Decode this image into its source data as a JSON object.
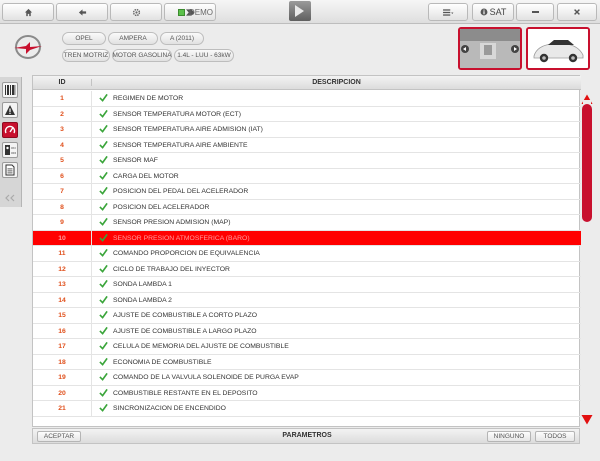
{
  "toolbar": {
    "demo_label": "DEMO",
    "sat_label": "SAT"
  },
  "vehicle": {
    "tags": [
      "OPEL",
      "AMPERA",
      "A (2011)",
      "TREN MOTRIZ",
      "MOTOR GASOLINA",
      "1.4L - LUU - 63kW"
    ]
  },
  "table": {
    "columns": [
      "ID",
      "DESCRIPCION"
    ],
    "selected_id": "10",
    "rows": [
      {
        "id": "1",
        "desc": "REGIMEN DE MOTOR"
      },
      {
        "id": "2",
        "desc": "SENSOR TEMPERATURA MOTOR (ECT)"
      },
      {
        "id": "3",
        "desc": "SENSOR TEMPERATURA AIRE ADMISION (IAT)"
      },
      {
        "id": "4",
        "desc": "SENSOR TEMPERATURA AIRE AMBIENTE"
      },
      {
        "id": "5",
        "desc": "SENSOR MAF"
      },
      {
        "id": "6",
        "desc": "CARGA DEL MOTOR"
      },
      {
        "id": "7",
        "desc": "POSICION DEL PEDAL DEL ACELERADOR"
      },
      {
        "id": "8",
        "desc": "POSICION DEL ACELERADOR"
      },
      {
        "id": "9",
        "desc": "SENSOR PRESION ADMISION (MAP)"
      },
      {
        "id": "10",
        "desc": "SENSOR PRESION ATMOSFERICA (BARO)"
      },
      {
        "id": "11",
        "desc": "COMANDO PROPORCION DE EQUIVALENCIA"
      },
      {
        "id": "12",
        "desc": "CICLO DE TRABAJO DEL INYECTOR"
      },
      {
        "id": "13",
        "desc": "SONDA LAMBDA 1"
      },
      {
        "id": "14",
        "desc": "SONDA LAMBDA 2"
      },
      {
        "id": "15",
        "desc": "AJUSTE DE COMBUSTIBLE A CORTO PLAZO"
      },
      {
        "id": "16",
        "desc": "AJUSTE DE COMBUSTIBLE A LARGO PLAZO"
      },
      {
        "id": "17",
        "desc": "CELULA DE MEMORIA DEL AJUSTE DE COMBUSTIBLE"
      },
      {
        "id": "18",
        "desc": "ECONOMIA DE COMBUSTIBLE"
      },
      {
        "id": "19",
        "desc": "COMANDO DE LA VALVULA SOLENOIDE DE PURGA EVAP"
      },
      {
        "id": "20",
        "desc": "COMBUSTIBLE RESTANTE EN EL DEPOSITO"
      },
      {
        "id": "21",
        "desc": "SINCRONIZACION DE ENCENDIDO"
      }
    ]
  },
  "bottom": {
    "accept_label": "ACEPTAR",
    "title": "PARAMETROS",
    "none_label": "NINGUNO",
    "all_label": "TODOS"
  },
  "colors": {
    "accent": "#c8102e",
    "selected_row": "#ff0000",
    "id_text": "#e0501c",
    "check": "#3aa53a"
  }
}
